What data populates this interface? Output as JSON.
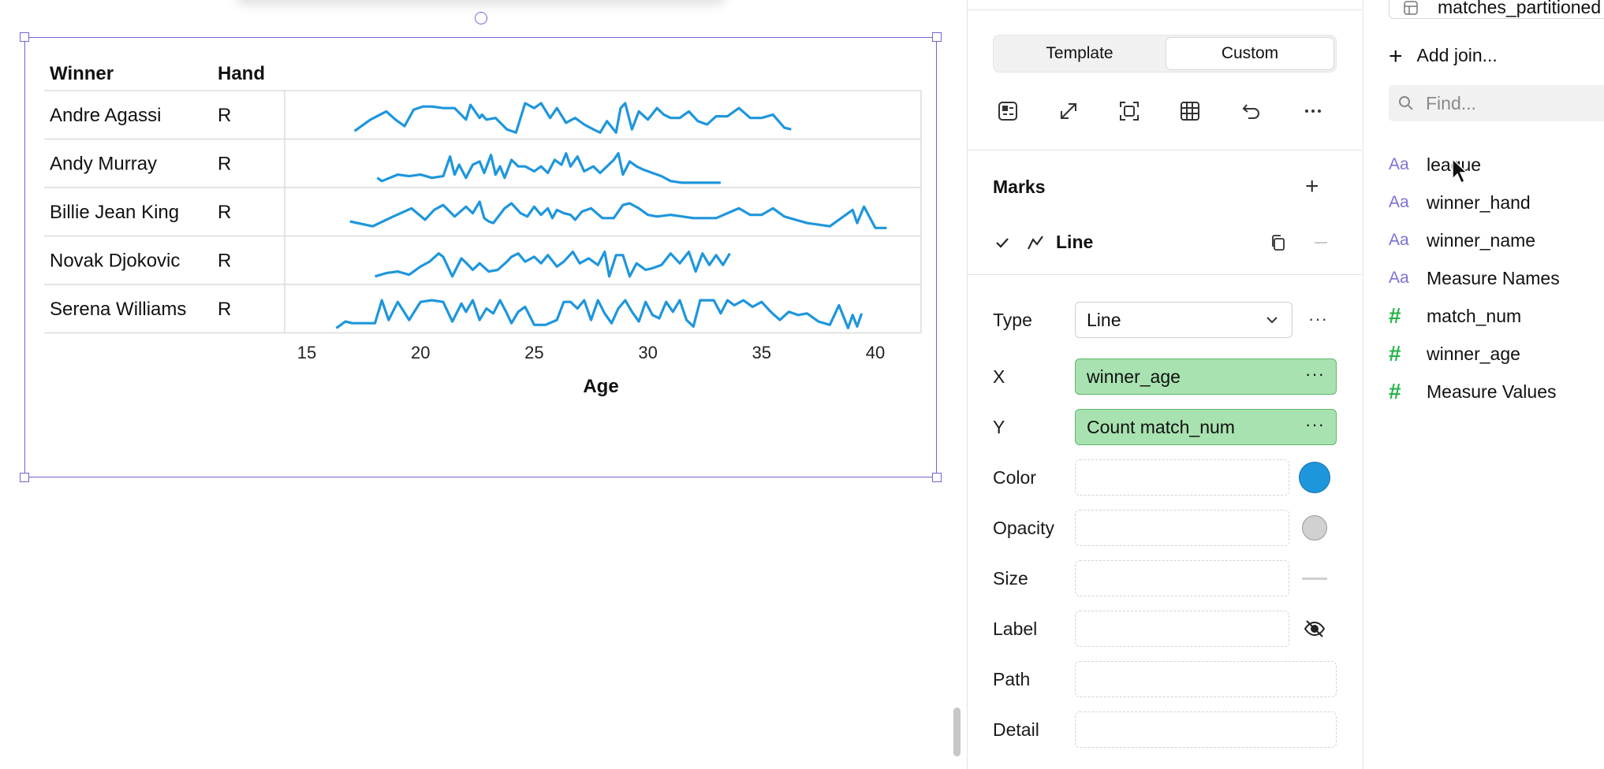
{
  "table": {
    "headers": {
      "winner": "Winner",
      "hand": "Hand"
    },
    "rows": [
      {
        "winner": "Andre Agassi",
        "hand": "R"
      },
      {
        "winner": "Andy Murray",
        "hand": "R"
      },
      {
        "winner": "Billie Jean King",
        "hand": "R"
      },
      {
        "winner": "Novak Djokovic",
        "hand": "R"
      },
      {
        "winner": "Serena Williams",
        "hand": "R"
      }
    ],
    "axis_title": "Age"
  },
  "chart_data": {
    "type": "line",
    "xlabel": "Age",
    "xlim": [
      14,
      42
    ],
    "x_ticks": [
      15,
      20,
      25,
      30,
      35,
      40
    ],
    "color": "#1e96dc",
    "series": [
      {
        "name": "Andre Agassi",
        "x": [
          17.1,
          17.8,
          18.5,
          18.9,
          19.3,
          19.7,
          20.1,
          20.5,
          21.0,
          21.5,
          22.0,
          22.2,
          22.6,
          22.7,
          22.9,
          23.3,
          23.8,
          24.2,
          24.6,
          25.0,
          25.3,
          25.7,
          26.0,
          26.4,
          26.8,
          27.2,
          27.6,
          27.9,
          28.2,
          28.6,
          28.8,
          29.0,
          29.3,
          29.6,
          30.0,
          30.4,
          30.7,
          31.0,
          31.4,
          31.8,
          32.2,
          32.6,
          33.0,
          33.5,
          34.0,
          34.5,
          35.0,
          35.5,
          36.0,
          36.3
        ],
        "y": [
          0.15,
          0.5,
          0.75,
          0.5,
          0.3,
          0.8,
          0.9,
          0.9,
          0.85,
          0.85,
          0.5,
          0.95,
          0.55,
          0.65,
          0.5,
          0.55,
          0.2,
          0.1,
          1.0,
          0.85,
          1.0,
          0.55,
          0.85,
          0.4,
          0.55,
          0.35,
          0.2,
          0.1,
          0.45,
          0.1,
          0.85,
          1.0,
          0.2,
          0.75,
          0.5,
          0.85,
          0.65,
          0.55,
          0.55,
          0.75,
          0.45,
          0.35,
          0.6,
          0.6,
          0.85,
          0.55,
          0.55,
          0.65,
          0.25,
          0.2
        ]
      },
      {
        "name": "Andy Murray",
        "x": [
          18.1,
          18.3,
          19.0,
          19.5,
          20.0,
          20.5,
          21.0,
          21.3,
          21.5,
          21.7,
          22.0,
          22.3,
          22.6,
          22.8,
          23.1,
          23.3,
          23.5,
          23.7,
          24.0,
          24.3,
          24.6,
          25.0,
          25.3,
          25.6,
          25.9,
          26.2,
          26.4,
          26.6,
          26.9,
          27.2,
          27.6,
          27.9,
          28.2,
          28.5,
          28.7,
          28.9,
          29.2,
          29.5,
          29.8,
          30.2,
          30.6,
          31.0,
          31.5,
          32.2,
          33.2
        ],
        "y": [
          0.2,
          0.1,
          0.3,
          0.25,
          0.3,
          0.2,
          0.25,
          0.85,
          0.3,
          0.6,
          0.2,
          0.6,
          0.7,
          0.35,
          0.9,
          0.3,
          0.55,
          0.2,
          0.75,
          0.55,
          0.55,
          0.4,
          0.55,
          0.35,
          0.75,
          0.6,
          0.95,
          0.55,
          0.85,
          0.4,
          0.55,
          0.35,
          0.55,
          0.75,
          0.95,
          0.3,
          0.7,
          0.55,
          0.45,
          0.35,
          0.25,
          0.1,
          0.05,
          0.05,
          0.05
        ]
      },
      {
        "name": "Billie Jean King",
        "x": [
          16.9,
          17.9,
          18.8,
          19.6,
          20.2,
          20.6,
          21.0,
          21.5,
          22.0,
          22.3,
          22.6,
          22.8,
          23.0,
          23.2,
          23.7,
          24.0,
          24.4,
          24.7,
          25.0,
          25.3,
          25.6,
          25.8,
          26.0,
          26.3,
          26.6,
          26.8,
          27.1,
          27.5,
          28.0,
          28.5,
          28.9,
          29.2,
          29.6,
          30.0,
          30.4,
          31.0,
          32.0,
          33.0,
          34.0,
          34.5,
          35.0,
          35.5,
          36.0,
          37.0,
          38.0,
          39.0,
          39.2,
          39.5,
          40.0,
          40.5
        ],
        "y": [
          0.35,
          0.2,
          0.5,
          0.75,
          0.4,
          0.7,
          0.85,
          0.5,
          0.8,
          0.6,
          0.95,
          0.45,
          0.35,
          0.3,
          0.75,
          0.9,
          0.6,
          0.5,
          0.8,
          0.55,
          0.75,
          0.45,
          0.7,
          0.6,
          0.55,
          0.4,
          0.65,
          0.75,
          0.45,
          0.45,
          0.85,
          0.9,
          0.75,
          0.55,
          0.5,
          0.55,
          0.45,
          0.45,
          0.75,
          0.55,
          0.55,
          0.75,
          0.5,
          0.3,
          0.2,
          0.7,
          0.3,
          0.8,
          0.15,
          0.15
        ]
      },
      {
        "name": "Novak Djokovic",
        "x": [
          18.0,
          18.5,
          19.0,
          19.5,
          20.0,
          20.4,
          20.8,
          21.0,
          21.4,
          21.8,
          22.1,
          22.3,
          22.6,
          23.0,
          23.4,
          23.8,
          24.0,
          24.3,
          24.6,
          25.0,
          25.3,
          25.6,
          26.0,
          26.3,
          26.7,
          27.0,
          27.4,
          27.8,
          28.1,
          28.3,
          28.6,
          28.9,
          29.2,
          29.5,
          29.9,
          30.2,
          30.6,
          31.0,
          31.4,
          31.8,
          32.1,
          32.4,
          32.7,
          33.0,
          33.3,
          33.6
        ],
        "y": [
          0.15,
          0.25,
          0.3,
          0.2,
          0.45,
          0.6,
          0.85,
          0.75,
          0.15,
          0.7,
          0.5,
          0.35,
          0.55,
          0.3,
          0.35,
          0.6,
          0.75,
          0.85,
          0.6,
          0.75,
          0.55,
          0.8,
          0.45,
          0.6,
          0.9,
          0.55,
          0.7,
          0.5,
          0.9,
          0.15,
          0.8,
          0.8,
          0.15,
          0.55,
          0.35,
          0.4,
          0.5,
          0.85,
          0.55,
          0.9,
          0.3,
          0.85,
          0.5,
          0.8,
          0.5,
          0.85
        ]
      },
      {
        "name": "Serena Williams",
        "x": [
          16.3,
          16.7,
          17.0,
          17.5,
          18.0,
          18.3,
          18.6,
          19.0,
          19.5,
          20.0,
          20.5,
          21.0,
          21.4,
          21.8,
          22.0,
          22.3,
          22.6,
          22.9,
          23.2,
          23.5,
          23.8,
          24.0,
          24.3,
          24.6,
          25.0,
          25.5,
          26.0,
          26.3,
          26.6,
          26.9,
          27.2,
          27.5,
          27.8,
          28.1,
          28.4,
          28.7,
          29.0,
          29.3,
          29.6,
          29.9,
          30.2,
          30.5,
          30.8,
          31.1,
          31.4,
          31.7,
          32.0,
          32.3,
          32.6,
          32.9,
          33.2,
          33.5,
          33.8,
          34.2,
          34.6,
          35.0,
          35.4,
          35.8,
          36.2,
          36.6,
          37.0,
          37.5,
          38.0,
          38.4,
          38.8,
          39.0,
          39.2,
          39.4
        ],
        "y": [
          0.05,
          0.25,
          0.2,
          0.2,
          0.2,
          0.9,
          0.3,
          0.85,
          0.3,
          0.85,
          0.9,
          0.85,
          0.25,
          0.8,
          0.55,
          0.9,
          0.3,
          0.65,
          0.5,
          0.9,
          0.5,
          0.2,
          0.55,
          0.7,
          0.15,
          0.15,
          0.3,
          0.85,
          0.85,
          0.65,
          0.9,
          0.3,
          0.9,
          0.5,
          0.2,
          0.65,
          0.9,
          0.55,
          0.25,
          0.85,
          0.45,
          0.35,
          0.85,
          0.55,
          0.9,
          0.3,
          0.1,
          0.9,
          0.9,
          0.9,
          0.5,
          0.9,
          0.75,
          0.9,
          0.7,
          0.85,
          0.55,
          0.3,
          0.55,
          0.45,
          0.5,
          0.25,
          0.15,
          0.75,
          0.05,
          0.45,
          0.1,
          0.5
        ]
      }
    ]
  },
  "panel": {
    "tabs": {
      "template": "Template",
      "custom": "Custom"
    },
    "marks_title": "Marks",
    "mark_name": "Line",
    "props": {
      "type_label": "Type",
      "type_value": "Line",
      "x_label": "X",
      "x_value": "winner_age",
      "y_label": "Y",
      "y_value": "Count match_num",
      "color_label": "Color",
      "color_value": "#1e96dc",
      "opacity_label": "Opacity",
      "size_label": "Size",
      "label_label": "Label",
      "path_label": "Path",
      "detail_label": "Detail"
    },
    "icons": [
      "template-icon",
      "expand-icon",
      "fit-icon",
      "table-icon",
      "undo-icon",
      "more-icon"
    ]
  },
  "data_panel": {
    "datasource": "matches_partitioned",
    "add_join": "Add join...",
    "find_placeholder": "Find...",
    "fields": [
      {
        "kind": "dimension",
        "icon": "Aa",
        "name": "league"
      },
      {
        "kind": "dimension",
        "icon": "Aa",
        "name": "winner_hand"
      },
      {
        "kind": "dimension",
        "icon": "Aa",
        "name": "winner_name"
      },
      {
        "kind": "dimension",
        "icon": "Aa",
        "name": "Measure Names"
      },
      {
        "kind": "measure",
        "icon": "#",
        "name": "match_num"
      },
      {
        "kind": "measure",
        "icon": "#",
        "name": "winner_age"
      },
      {
        "kind": "measure",
        "icon": "#",
        "name": "Measure Values"
      }
    ]
  }
}
